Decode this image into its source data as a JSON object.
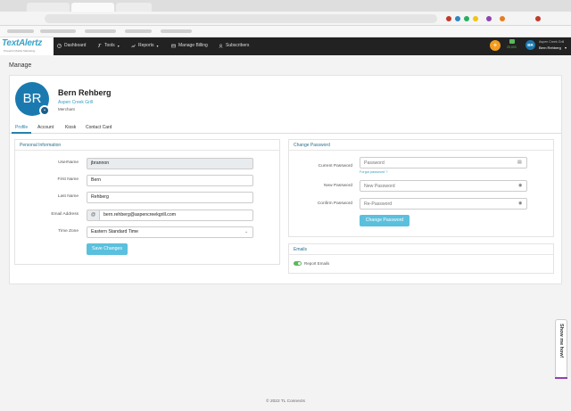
{
  "navbar": {
    "logo_text": "TextAlertz",
    "logo_tagline": "Powerful Mobile Marketing",
    "items": [
      {
        "label": "Dashboard",
        "icon": "dashboard-icon"
      },
      {
        "label": "Tools",
        "icon": "tools-icon"
      },
      {
        "label": "Reports",
        "icon": "chart-icon"
      },
      {
        "label": "Manage Billing",
        "icon": "billing-icon"
      },
      {
        "label": "Subscribers",
        "icon": "users-icon"
      }
    ],
    "notification_icon": "+",
    "credits": "25,000",
    "user_initials": "BR",
    "user_org": "Aspen Creek Grill",
    "user_name": "Bern Rehberg"
  },
  "page": {
    "title": "Manage"
  },
  "profile": {
    "initials": "BR",
    "name": "Bern Rehberg",
    "organization": "Aspen Creek Grill",
    "role": "Merchant"
  },
  "tabs": [
    {
      "label": "Profile",
      "active": true
    },
    {
      "label": "Account",
      "active": false
    },
    {
      "label": "Kiosk",
      "active": false
    },
    {
      "label": "Contact Card",
      "active": false
    }
  ],
  "personal_info": {
    "heading": "Personal Information",
    "username_label": "UserName",
    "username_value": "jbrannon",
    "first_name_label": "First Name",
    "first_name_value": "Bern",
    "last_name_label": "Last Name",
    "last_name_value": "Rehberg",
    "email_label": "Email Address",
    "email_value": "bern.rehberg@aspencreekgrill.com",
    "email_addon": "@",
    "timezone_label": "Time Zone",
    "timezone_value": "Eastern Standard Time",
    "save_label": "Save Changes"
  },
  "change_password": {
    "heading": "Change Password",
    "current_label": "Current Password",
    "current_placeholder": "Password",
    "forgot_label": "Forgot password ?",
    "new_label": "New Password",
    "new_placeholder": "New Password",
    "confirm_label": "Confirm Password",
    "confirm_placeholder": "Re-Password",
    "button_label": "Change Password"
  },
  "emails": {
    "heading": "Emails",
    "report_label": "Report Emails",
    "report_enabled": true
  },
  "footer": {
    "text": "© 2022 TL Connects"
  },
  "help_widget": {
    "label": "Show me how!"
  },
  "colors": {
    "accent": "#5bc0de",
    "brand_blue": "#1a7ab0",
    "navbar": "#222222",
    "notification": "#f39c1f",
    "toggle_on": "#5cb85c"
  }
}
